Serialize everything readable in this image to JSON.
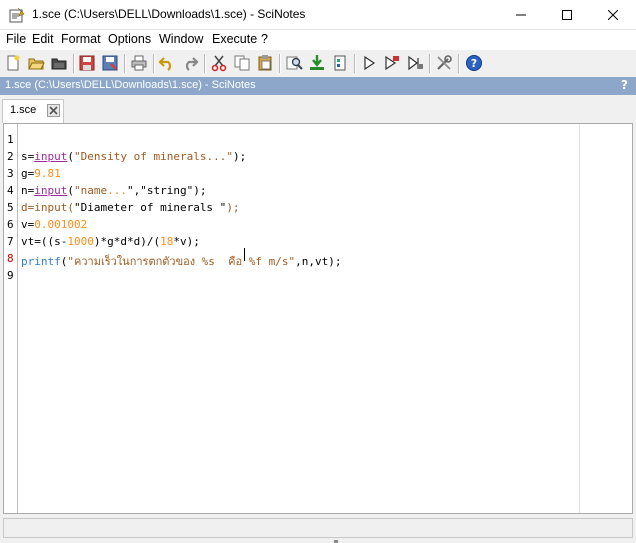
{
  "window": {
    "title": "1.sce (C:\\Users\\DELL\\Downloads\\1.sce) - SciNotes",
    "minimize_label": "—",
    "maximize_label": "☐",
    "close_label": "✕"
  },
  "menu": [
    "File",
    "Edit",
    "Format",
    "Options",
    "Window",
    "Execute",
    "?"
  ],
  "toolbar_icons": [
    "new-file-icon",
    "open-file-icon",
    "open-folder-icon",
    "save-icon",
    "save-as-icon",
    "print-icon",
    "undo-icon",
    "redo-icon",
    "cut-icon",
    "copy-icon",
    "paste-icon",
    "find-replace-icon",
    "load-into-console-icon",
    "execute-file-icon",
    "execute-icon",
    "execute-with-echo-icon",
    "execute-until-cursor-icon",
    "preferences-icon",
    "help-icon"
  ],
  "path_bar": {
    "text": "1.sce (C:\\Users\\DELL\\Downloads\\1.sce) - SciNotes",
    "help": "?"
  },
  "tab": {
    "label": "1.sce"
  },
  "editor": {
    "line_numbers": [
      "1",
      "2",
      "3",
      "4",
      "5",
      "6",
      "7",
      "8",
      "9"
    ],
    "current_line": "8",
    "lines": [
      [],
      [
        {
          "t": "s",
          "c": "c-var"
        },
        {
          "t": "=",
          "c": "c-op"
        },
        {
          "t": "input",
          "c": "c-fn"
        },
        {
          "t": "(",
          "c": "c-op"
        },
        {
          "t": "\"Density of minerals...\"",
          "c": "c-str"
        },
        {
          "t": ");",
          "c": "c-op"
        }
      ],
      [
        {
          "t": "g",
          "c": "c-var"
        },
        {
          "t": "=",
          "c": "c-op"
        },
        {
          "t": "9.81",
          "c": "c-num"
        }
      ],
      [
        {
          "t": "n",
          "c": "c-var"
        },
        {
          "t": "=",
          "c": "c-op"
        },
        {
          "t": "input",
          "c": "c-fn"
        },
        {
          "t": "(",
          "c": "c-op"
        },
        {
          "t": "\"name",
          "c": "c-str"
        },
        {
          "t": "...",
          "c": "c-num"
        },
        {
          "t": "\",\"string\");",
          "c": "c-plain-str"
        }
      ],
      [
        {
          "t": "d=input(",
          "c": "c-str"
        },
        {
          "t": "\"Diameter of minerals \"",
          "c": "c-plain-str"
        },
        {
          "t": ");",
          "c": "c-str"
        }
      ],
      [
        {
          "t": "v",
          "c": "c-var"
        },
        {
          "t": "=",
          "c": "c-op"
        },
        {
          "t": "0.001002",
          "c": "c-num"
        }
      ],
      [
        {
          "t": "vt",
          "c": "c-var"
        },
        {
          "t": "=((",
          "c": "c-op"
        },
        {
          "t": "s",
          "c": "c-var"
        },
        {
          "t": "-",
          "c": "c-op"
        },
        {
          "t": "1000",
          "c": "c-num"
        },
        {
          "t": ")*",
          "c": "c-op"
        },
        {
          "t": "g",
          "c": "c-var"
        },
        {
          "t": "*",
          "c": "c-op"
        },
        {
          "t": "d",
          "c": "c-var"
        },
        {
          "t": "*",
          "c": "c-op"
        },
        {
          "t": "d",
          "c": "c-var"
        },
        {
          "t": ")/(",
          "c": "c-op"
        },
        {
          "t": "18",
          "c": "c-num"
        },
        {
          "t": "*",
          "c": "c-op"
        },
        {
          "t": "v",
          "c": "c-var"
        },
        {
          "t": ");",
          "c": "c-op"
        }
      ],
      [
        {
          "t": "printf",
          "c": "c-bi"
        },
        {
          "t": "(",
          "c": "c-op"
        },
        {
          "t": "\"ความเร็วในการตกตัวของ %s  คือ %f m/s\"",
          "c": "c-str"
        },
        {
          "t": ",n,vt);",
          "c": "c-op"
        }
      ],
      []
    ]
  },
  "colors": {
    "path_bar": "#8ca7c9",
    "keyword_function": "#9b2d9b",
    "string": "#a05a1e",
    "number": "#ff8c1a",
    "builtin": "#2f7dd6",
    "current_line_number": "#d00000"
  }
}
